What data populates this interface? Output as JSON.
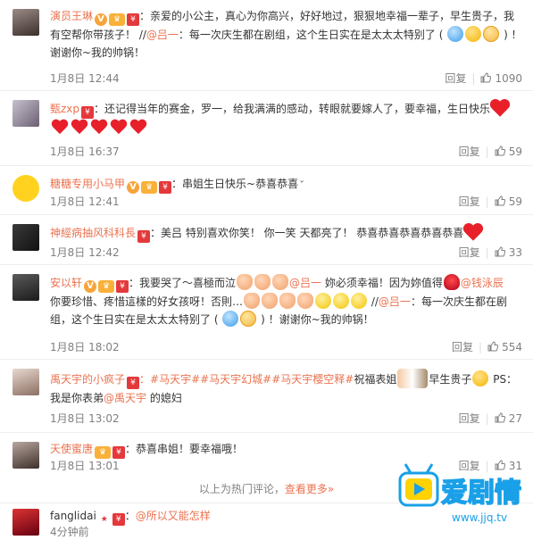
{
  "comments": [
    {
      "name": "演员王琳",
      "text": "：亲爱的小公主，真心为你高兴，好好地过，狠狠地幸福一辈子，早生贵子，我有空帮你带孩子！ //",
      "mention": "@吕一",
      "text2": "：每一次庆生都在剧组，这个生日实在是太太太特别了 ( ",
      "text3": " ) ！谢谢你~我的帅锅！",
      "time": "1月8日 12:44",
      "reply": "回复",
      "likes": "1090"
    },
    {
      "name": "甄zxp",
      "text": "：还记得当年的赛金，罗一，给我满满的感动，转眼就要嫁人了，要幸福，生日快乐",
      "time": "1月8日 16:37",
      "reply": "回复",
      "likes": "59"
    },
    {
      "name": "糖糖专用小马甲",
      "text": "：串姐生日快乐~恭喜恭喜",
      "time": "1月8日 12:41",
      "reply": "回复",
      "likes": "59"
    },
    {
      "name": "神經病抽风科科長",
      "text": "：美吕 特别喜欢你笑！ 你一笑 天都亮了！ 恭喜恭喜恭喜恭喜恭喜",
      "time": "1月8日 12:42",
      "reply": "回复",
      "likes": "33"
    },
    {
      "name": "安以轩",
      "text": "：我要哭了～喜極而泣",
      "mention": "@吕一",
      "text2": " 妳必须幸福！因为妳值得",
      "mention2": "@钱泳辰",
      "text3": "你要珍惜、疼惜這樣的好女孩呀！否則…",
      "mention3": "@吕一",
      "text4": "：每一次庆生都在剧组，这个生日实在是太太太特别了 ( ",
      "text5": " ) ！谢谢你~我的帅锅！",
      "time": "1月8日 18:02",
      "reply": "回复",
      "likes": "554"
    },
    {
      "name": "禹天宇的小疯子",
      "tags": "：#马天宇##马天宇幻城##马天宇樱空释#",
      "text": "祝福表姐",
      "text2": "早生贵子",
      "text3": " PS：我是你表弟",
      "mention": "@禹天宇",
      "text4": " 的媳妇",
      "time": "1月8日 13:02",
      "reply": "回复",
      "likes": "27"
    },
    {
      "name": "天使蜜唐",
      "text": "：恭喜串姐！要幸福哦！",
      "time": "1月8日 13:01",
      "reply": "回复",
      "likes": "31"
    },
    {
      "name": "fanglidai",
      "text": "：",
      "mention": "@所以又能怎样",
      "time": "4分钟前"
    }
  ],
  "footer": {
    "text": "以上为热门评论，",
    "more": "查看更多»"
  },
  "watermark": {
    "brand": "爱剧情",
    "url": "www.jjq.tv"
  },
  "colors": {
    "name": "#eb7350",
    "text": "#333333",
    "meta": "#808080",
    "heart": "#e8202a"
  }
}
